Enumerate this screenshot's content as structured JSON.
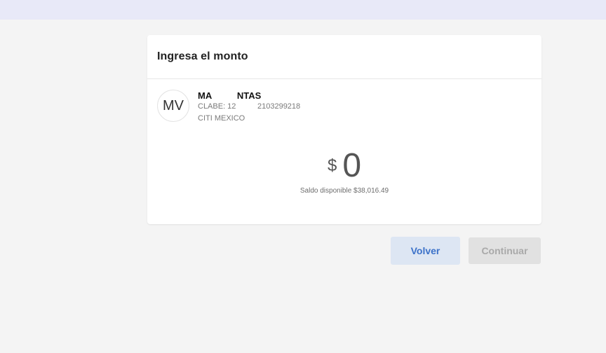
{
  "header": {
    "title": "Ingresa el monto"
  },
  "recipient": {
    "initials": "MV",
    "name": "MA          NTAS",
    "clabe": "CLABE: 12          2103299218",
    "bank": "CITI MEXICO"
  },
  "amount": {
    "currency": "$",
    "value": "0",
    "balance_text": "Saldo disponible $38,016.49"
  },
  "actions": {
    "back_label": "Volver",
    "continue_label": "Continuar"
  },
  "colors": {
    "topbar": "#e8e9f8",
    "background": "#f4f4f4",
    "primary_text": "#3c72c9",
    "back_button_bg": "#dde6f3",
    "disabled_button_bg": "#e1e1e1"
  }
}
